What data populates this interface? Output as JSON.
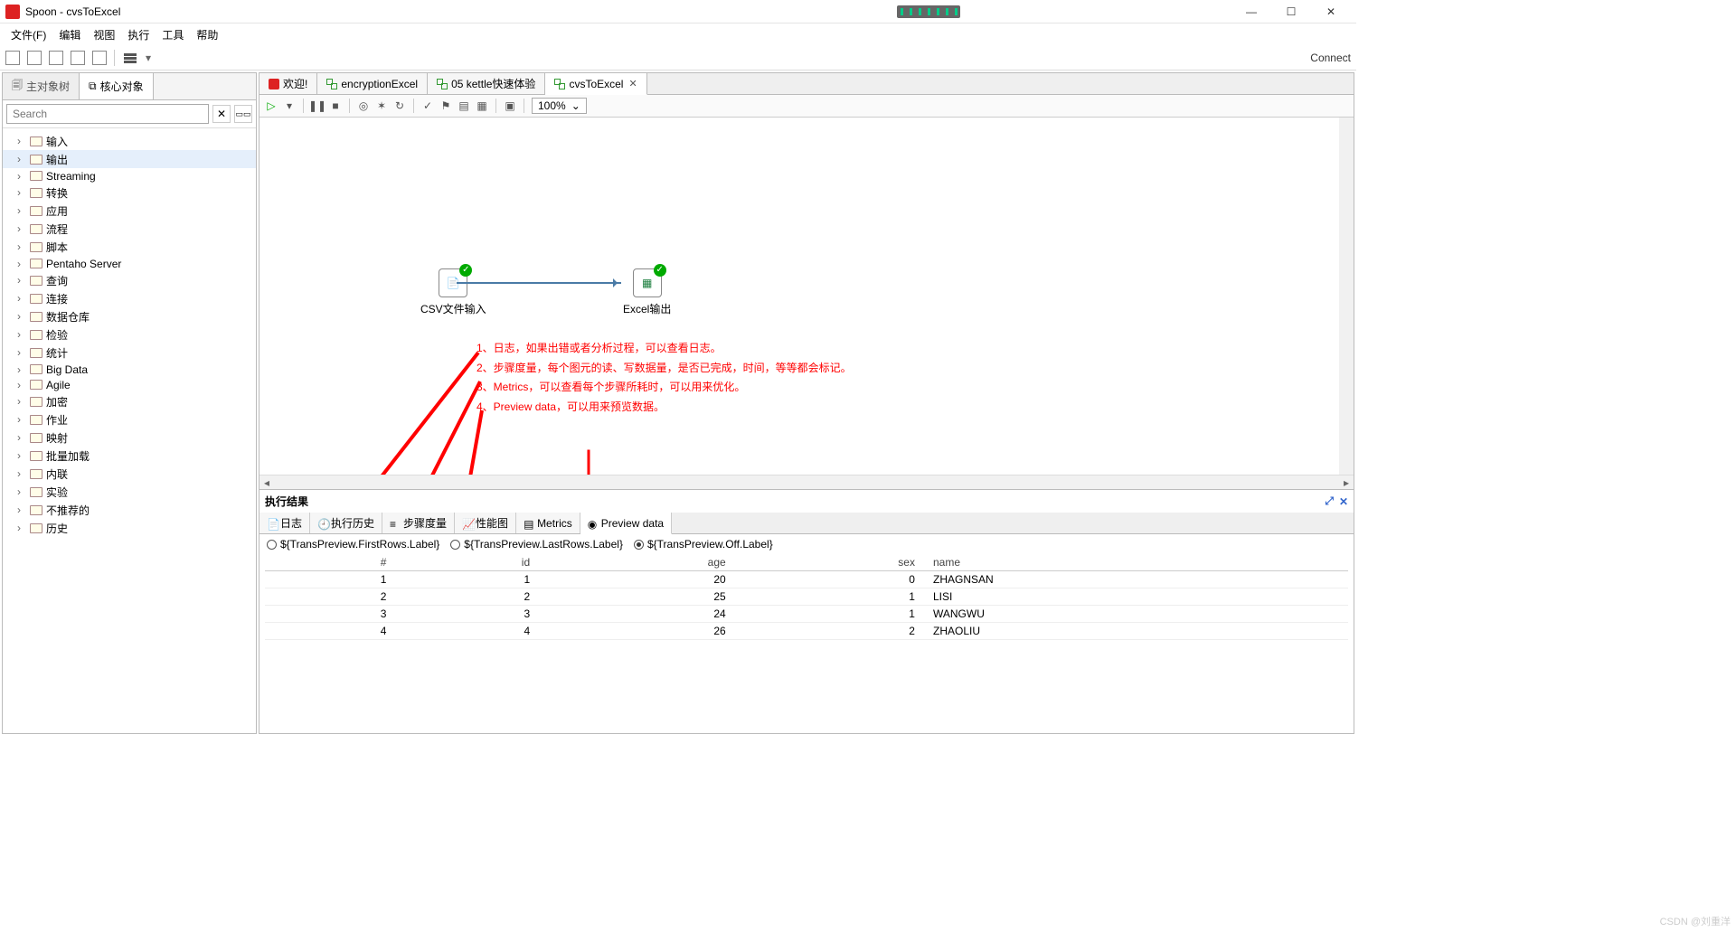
{
  "window": {
    "title": "Spoon - cvsToExcel"
  },
  "menus": [
    "文件(F)",
    "编辑",
    "视图",
    "执行",
    "工具",
    "帮助"
  ],
  "toolbar_right": "Connect",
  "sidebar": {
    "tabs": [
      "主对象树",
      "核心对象"
    ],
    "search_placeholder": "Search",
    "items": [
      {
        "label": "输入",
        "sel": false
      },
      {
        "label": "输出",
        "sel": true
      },
      {
        "label": "Streaming",
        "sel": false
      },
      {
        "label": "转换",
        "sel": false
      },
      {
        "label": "应用",
        "sel": false
      },
      {
        "label": "流程",
        "sel": false
      },
      {
        "label": "脚本",
        "sel": false
      },
      {
        "label": "Pentaho Server",
        "sel": false
      },
      {
        "label": "查询",
        "sel": false
      },
      {
        "label": "连接",
        "sel": false
      },
      {
        "label": "数据仓库",
        "sel": false
      },
      {
        "label": "检验",
        "sel": false
      },
      {
        "label": "统计",
        "sel": false
      },
      {
        "label": "Big Data",
        "sel": false
      },
      {
        "label": "Agile",
        "sel": false
      },
      {
        "label": "加密",
        "sel": false
      },
      {
        "label": "作业",
        "sel": false
      },
      {
        "label": "映射",
        "sel": false
      },
      {
        "label": "批量加载",
        "sel": false
      },
      {
        "label": "内联",
        "sel": false
      },
      {
        "label": "实验",
        "sel": false
      },
      {
        "label": "不推荐的",
        "sel": false
      },
      {
        "label": "历史",
        "sel": false
      }
    ]
  },
  "doc_tabs": [
    {
      "label": "欢迎!",
      "icon": "red"
    },
    {
      "label": "encryptionExcel",
      "icon": "grn"
    },
    {
      "label": "05 kettle快速体验",
      "icon": "grn"
    },
    {
      "label": "cvsToExcel",
      "icon": "grn",
      "active": true
    }
  ],
  "zoom": "100%",
  "nodes": {
    "csv": "CSV文件输入",
    "excel": "Excel输出"
  },
  "annotations": [
    "1、日志，如果出错或者分析过程，可以查看日志。",
    "2、步骤度量，每个图元的读、写数据量，是否已完成，时间，等等都会标记。",
    "3、Metrics，可以查看每个步骤所耗时，可以用来优化。",
    "4、Preview data，可以用来预览数据。"
  ],
  "results": {
    "title": "执行结果",
    "tabs": [
      "日志",
      "执行历史",
      "步骤度量",
      "性能图",
      "Metrics",
      "Preview data"
    ],
    "preview_radios": [
      "${TransPreview.FirstRows.Label}",
      "${TransPreview.LastRows.Label}",
      "${TransPreview.Off.Label}"
    ],
    "columns": [
      "#",
      "id",
      "age",
      "sex",
      "name"
    ],
    "rows": [
      {
        "n": "1",
        "id": "1",
        "age": "20",
        "sex": "0",
        "name": "ZHAGNSAN"
      },
      {
        "n": "2",
        "id": "2",
        "age": "25",
        "sex": "1",
        "name": "LISI"
      },
      {
        "n": "3",
        "id": "3",
        "age": "24",
        "sex": "1",
        "name": "WANGWU"
      },
      {
        "n": "4",
        "id": "4",
        "age": "26",
        "sex": "2",
        "name": "ZHAOLIU"
      }
    ]
  },
  "watermark": "CSDN @刘重洋"
}
